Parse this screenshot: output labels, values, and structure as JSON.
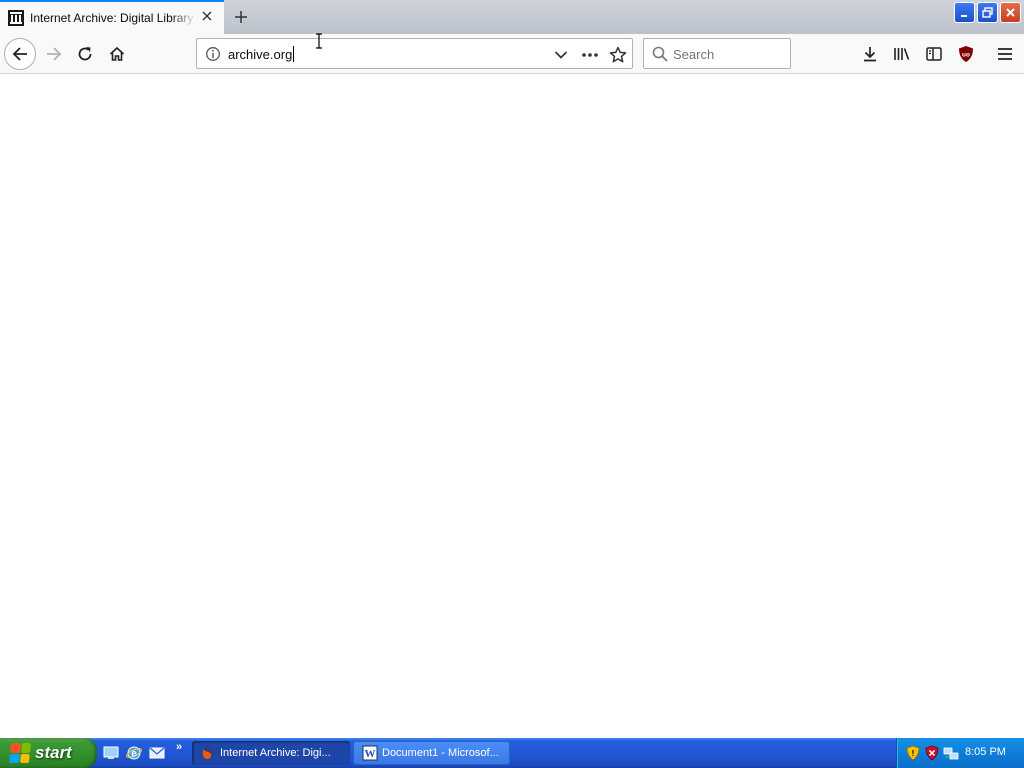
{
  "browser": {
    "tab": {
      "title": "Internet Archive: Digital Library of Free & Borrowable Books, Movies, Music & Wayback Machine",
      "favicon": "internet-archive-icon"
    },
    "url": "archive.org",
    "search_placeholder": "Search",
    "icons": {
      "back": "back-arrow-icon",
      "forward": "forward-arrow-icon",
      "reload": "reload-icon",
      "home": "home-icon",
      "page_actions": "more-actions-icon",
      "bookmark": "star-icon",
      "downloads": "download-icon",
      "library": "library-icon",
      "sidebar": "sidebar-icon",
      "ublock": "ublock-origin-icon",
      "menu": "hamburger-menu-icon"
    },
    "accent_color": "#0a84ff"
  },
  "taskbar": {
    "start_label": "start",
    "tasks": [
      {
        "label": "Internet Archive: Digi...",
        "icon": "firefox-icon",
        "active": true
      },
      {
        "label": "Document1 - Microsof...",
        "icon": "word-icon",
        "active": false
      }
    ],
    "quick_more": "»",
    "clock": "8:05 PM"
  }
}
